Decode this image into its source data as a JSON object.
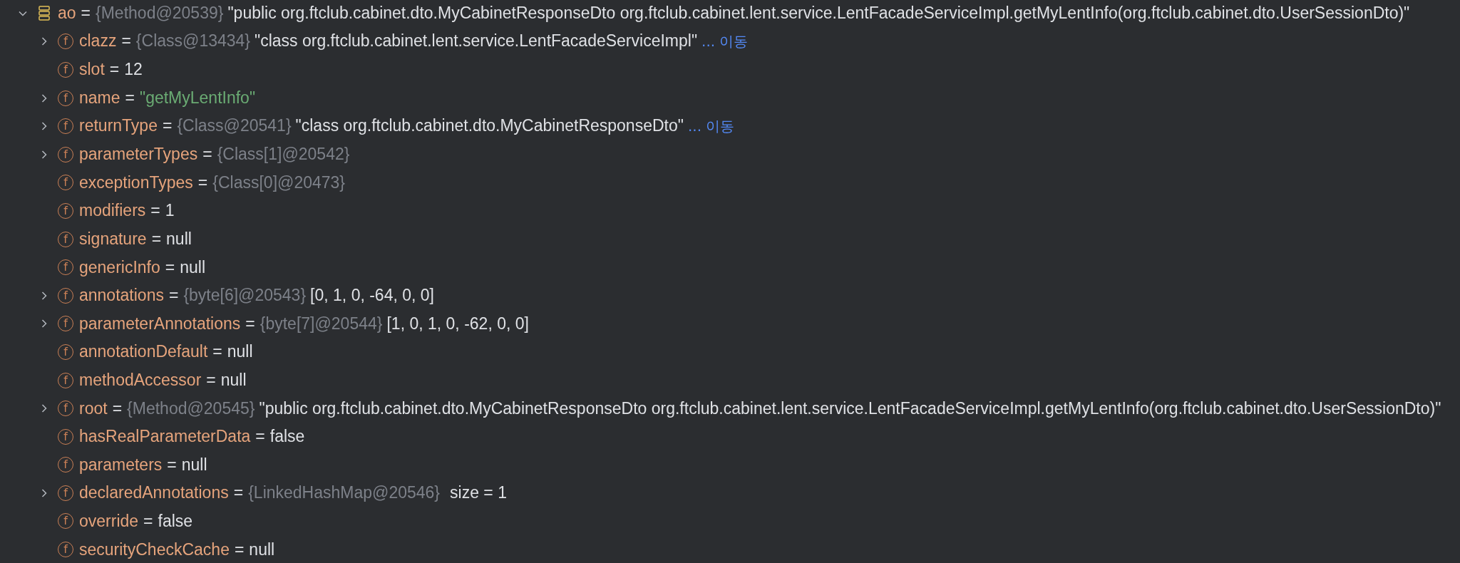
{
  "tree": [
    {
      "kind": "object",
      "name": "ao",
      "eq": "=",
      "ref": "{Method@20539}",
      "value": {
        "kind": "plain",
        "text": "\"public org.ftclub.cabinet.dto.MyCabinetResponseDto org.ftclub.cabinet.lent.service.LentFacadeServiceImpl.getMyLentInfo(org.ftclub.cabinet.dto.UserSessionDto)\""
      },
      "expanded": true,
      "children": [
        {
          "kind": "field",
          "icon_letter": "f",
          "name": "clazz",
          "eq": "=",
          "ref": "{Class@13434}",
          "value": {
            "kind": "plain",
            "text": "\"class org.ftclub.cabinet.lent.service.LentFacadeServiceImpl\""
          },
          "navigate": "... 이동",
          "expanded": false
        },
        {
          "kind": "field",
          "icon_letter": "f",
          "name": "slot",
          "eq": "=",
          "value": {
            "kind": "plain",
            "text": "12"
          }
        },
        {
          "kind": "field",
          "icon_letter": "f",
          "name": "name",
          "eq": "=",
          "value": {
            "kind": "string",
            "text": "\"getMyLentInfo\""
          },
          "expanded": false
        },
        {
          "kind": "field",
          "icon_letter": "f",
          "name": "returnType",
          "eq": "=",
          "ref": "{Class@20541}",
          "value": {
            "kind": "plain",
            "text": "\"class org.ftclub.cabinet.dto.MyCabinetResponseDto\""
          },
          "navigate": "... 이동",
          "expanded": false
        },
        {
          "kind": "field",
          "icon_letter": "f",
          "name": "parameterTypes",
          "eq": "=",
          "ref": "{Class[1]@20542}",
          "expanded": false
        },
        {
          "kind": "field",
          "icon_letter": "f",
          "name": "exceptionTypes",
          "eq": "=",
          "ref": "{Class[0]@20473}"
        },
        {
          "kind": "field",
          "icon_letter": "f",
          "name": "modifiers",
          "eq": "=",
          "value": {
            "kind": "plain",
            "text": "1"
          }
        },
        {
          "kind": "field",
          "icon_letter": "f",
          "name": "signature",
          "eq": "=",
          "value": {
            "kind": "plain",
            "text": "null"
          }
        },
        {
          "kind": "field",
          "icon_letter": "f",
          "name": "genericInfo",
          "eq": "=",
          "value": {
            "kind": "plain",
            "text": "null"
          }
        },
        {
          "kind": "field",
          "icon_letter": "f",
          "name": "annotations",
          "eq": "=",
          "ref": "{byte[6]@20543}",
          "value": {
            "kind": "plain",
            "text": "[0, 1, 0, -64, 0, 0]"
          },
          "expanded": false
        },
        {
          "kind": "field",
          "icon_letter": "f",
          "name": "parameterAnnotations",
          "eq": "=",
          "ref": "{byte[7]@20544}",
          "value": {
            "kind": "plain",
            "text": "[1, 0, 1, 0, -62, 0, 0]"
          },
          "expanded": false
        },
        {
          "kind": "field",
          "icon_letter": "f",
          "name": "annotationDefault",
          "eq": "=",
          "value": {
            "kind": "plain",
            "text": "null"
          }
        },
        {
          "kind": "field",
          "icon_letter": "f",
          "name": "methodAccessor",
          "eq": "=",
          "value": {
            "kind": "plain",
            "text": "null"
          }
        },
        {
          "kind": "field",
          "icon_letter": "f",
          "name": "root",
          "eq": "=",
          "ref": "{Method@20545}",
          "value": {
            "kind": "plain",
            "text": "\"public org.ftclub.cabinet.dto.MyCabinetResponseDto org.ftclub.cabinet.lent.service.LentFacadeServiceImpl.getMyLentInfo(org.ftclub.cabinet.dto.UserSessionDto)\""
          },
          "expanded": false
        },
        {
          "kind": "field",
          "icon_letter": "f",
          "name": "hasRealParameterData",
          "eq": "=",
          "value": {
            "kind": "plain",
            "text": "false"
          }
        },
        {
          "kind": "field",
          "icon_letter": "f",
          "name": "parameters",
          "eq": "=",
          "value": {
            "kind": "plain",
            "text": "null"
          }
        },
        {
          "kind": "field",
          "icon_letter": "f",
          "name": "declaredAnnotations",
          "eq": "=",
          "ref": "{LinkedHashMap@20546}",
          "value": {
            "kind": "size",
            "text": "size = 1"
          },
          "expanded": false
        },
        {
          "kind": "field",
          "icon_letter": "f",
          "name": "override",
          "eq": "=",
          "value": {
            "kind": "plain",
            "text": "false"
          }
        },
        {
          "kind": "field",
          "icon_letter": "f",
          "name": "securityCheckCache",
          "eq": "=",
          "value": {
            "kind": "plain",
            "text": "null"
          }
        }
      ]
    }
  ]
}
